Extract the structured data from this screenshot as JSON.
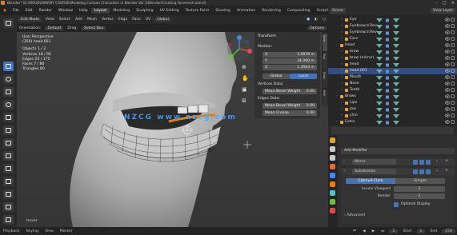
{
  "titlebar": {
    "text": "Blender* [D:\\MOUDOWN\\MY COURSE\\Modeling Cartoon Characters in Blender Vol 1\\Blender\\Creating Facemesh.blend]"
  },
  "menubar": {
    "menus": [
      "File",
      "Edit",
      "Render",
      "Window",
      "Help"
    ],
    "workspaces": [
      "Layout",
      "Modeling",
      "Sculpting",
      "UV Editing",
      "Texture Paint",
      "Shading",
      "Animation",
      "Rendering",
      "Compositing",
      "Scripting"
    ],
    "active_workspace": "Layout",
    "scene": "Scene",
    "view_layer": "View Layer"
  },
  "viewport": {
    "mode": "Edit Mode",
    "menus": [
      "View",
      "Select",
      "Add",
      "Mesh",
      "Vertex",
      "Edge",
      "Face",
      "UV"
    ],
    "orientation": "Global",
    "header2": {
      "orientation_label": "Orientation:",
      "orientation": "Default",
      "drag_label": "Drag:",
      "drag": "Select Box",
      "options": "Options"
    },
    "info": [
      "User Perspective",
      "(350) head.001",
      "",
      "Objects    1 / 2",
      "Vertices  18 / 95",
      "Edges     20 / 175",
      "Faces      7 / 80",
      "Triangles  80"
    ],
    "hint": "Hover",
    "watermark": "NZCG  www.nzcg.com"
  },
  "npanel": {
    "tabs": [
      "Item",
      "Tool",
      "View",
      "Edit"
    ],
    "title": "Transform",
    "median_label": "Median:",
    "x": {
      "k": "X",
      "v": "3.5878 m"
    },
    "y": {
      "k": "Y",
      "v": "34.000 m"
    },
    "z": {
      "k": "Z",
      "v": "1.3563 m"
    },
    "global": "Global",
    "local": "Local",
    "vertices_data": "Vertices Data:",
    "mean_bevel_weight_v": {
      "k": "Mean Bevel Weight",
      "v": "0.00"
    },
    "edges_data": "Edges Data:",
    "mean_bevel_weight_e": {
      "k": "Mean Bevel Weight",
      "v": "0.00"
    },
    "mean_crease": {
      "k": "Mean Crease",
      "v": "0.00"
    }
  },
  "outliner": {
    "rows": [
      {
        "name": "Eye",
        "depth": 2,
        "color": "#e8a33a",
        "sel": false
      },
      {
        "name": "Eyebrow.d.Rev",
        "depth": 2,
        "color": "#e8a33a",
        "sel": false
      },
      {
        "name": "Eyebrow.d.Rev",
        "depth": 2,
        "color": "#e8a33a",
        "sel": false
      },
      {
        "name": "Ears",
        "depth": 2,
        "color": "#e8a33a",
        "sel": false
      },
      {
        "name": "Head",
        "depth": 1,
        "color": "#e8a33a",
        "sel": false
      },
      {
        "name": "brow",
        "depth": 2,
        "color": "#e8a33a",
        "sel": false
      },
      {
        "name": "brow (mirror)",
        "depth": 2,
        "color": "#e8a33a",
        "sel": false
      },
      {
        "name": "head",
        "depth": 2,
        "color": "#e8a33a",
        "sel": false
      },
      {
        "name": "head.001",
        "depth": 2,
        "color": "#e8a33a",
        "sel": true
      },
      {
        "name": "Mouth",
        "depth": 2,
        "color": "#e8a33a",
        "sel": false
      },
      {
        "name": "Nose",
        "depth": 2,
        "color": "#e8a33a",
        "sel": false
      },
      {
        "name": "Teeth",
        "depth": 2,
        "color": "#e8a33a",
        "sel": false
      },
      {
        "name": "Brows",
        "depth": 1,
        "color": "#e8a33a",
        "sel": false
      },
      {
        "name": "Lips",
        "depth": 2,
        "color": "#e8a33a",
        "sel": false
      },
      {
        "name": "jaw",
        "depth": 2,
        "color": "#e8a33a",
        "sel": false
      },
      {
        "name": "chin",
        "depth": 2,
        "color": "#e8a33a",
        "sel": false
      },
      {
        "name": "Extra",
        "depth": 1,
        "color": "#e8a33a",
        "sel": false
      }
    ]
  },
  "properties": {
    "object_name": "head.001",
    "modifier_type": "Subdivision",
    "add_modifier": "Add Modifier",
    "mirror": "Mirror",
    "subsurf_name": "Subdivision",
    "catmull": "Catmull-Clark",
    "simple": "Simple",
    "levels_viewport": {
      "k": "Levels Viewport",
      "v": "2"
    },
    "render": {
      "k": "Render",
      "v": "2"
    },
    "optimal_display": "Optimal Display",
    "advanced": "Advanced"
  },
  "statusbar": [
    "Playback",
    "Keying",
    "View",
    "Marker",
    "1",
    "250",
    "Start",
    "End"
  ],
  "colors": {
    "accent": "#4772b3",
    "selection": "#334d80",
    "orange": "#e87d0d",
    "watermark": "#4aa3ff"
  }
}
